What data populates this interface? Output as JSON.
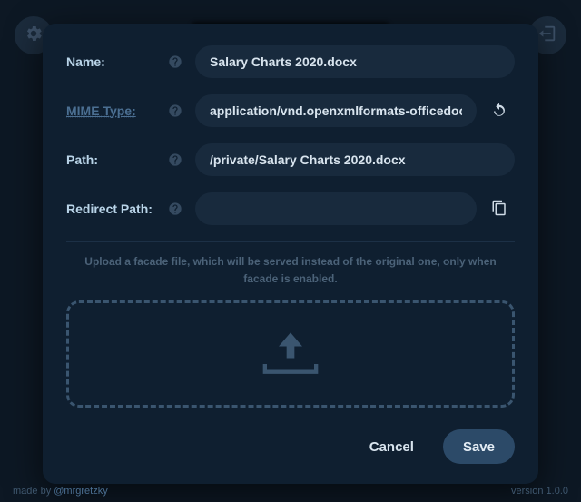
{
  "header": {
    "settings_icon": "gear",
    "logout_icon": "logout"
  },
  "form": {
    "name": {
      "label": "Name:",
      "value": "Salary Charts 2020.docx"
    },
    "mime": {
      "label": "MIME Type:",
      "value": "application/vnd.openxmlformats-officedocum"
    },
    "path": {
      "label": "Path:",
      "value": "/private/Salary Charts 2020.docx"
    },
    "redirect": {
      "label": "Redirect Path:",
      "value": ""
    },
    "help_text": "Upload a facade file, which will be served instead of the original one, only when facade is enabled.",
    "buttons": {
      "cancel": "Cancel",
      "save": "Save"
    }
  },
  "footer": {
    "made_prefix": "made by ",
    "made_handle": "@mrgretzky",
    "version": "version 1.0.0"
  }
}
